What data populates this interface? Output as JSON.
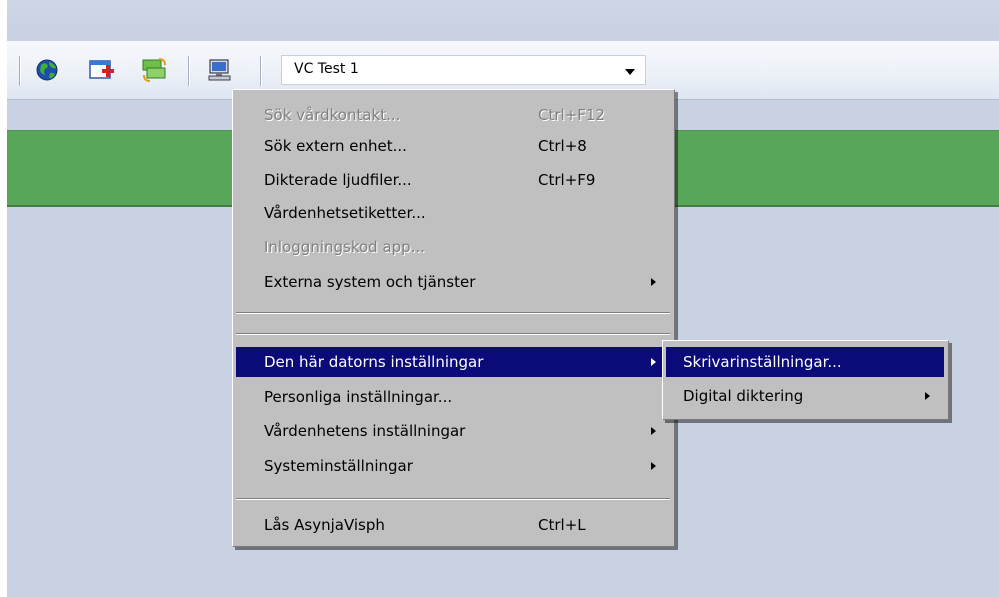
{
  "toolbar": {
    "buttons": [
      {
        "icon": "globe-icon"
      },
      {
        "icon": "add-window-icon"
      },
      {
        "icon": "money-exchange-icon"
      },
      {
        "icon": "computer-icon"
      }
    ],
    "combo_value": "VC Test 1"
  },
  "menu": {
    "items": [
      {
        "label": "Sök vårdkontakt...",
        "shortcut": "Ctrl+F12",
        "disabled": true
      },
      {
        "label": "Sök extern enhet...",
        "shortcut": "Ctrl+8"
      },
      {
        "label": "Dikterade ljudfiler...",
        "shortcut": "Ctrl+F9"
      },
      {
        "label": "Vårdenhetsetiketter..."
      },
      {
        "label": "Inloggningskod app...",
        "disabled": true
      },
      {
        "label": "Externa system och tjänster",
        "submenu": true
      },
      {
        "label": "Den här datorns inställningar",
        "submenu": true,
        "selected": true
      },
      {
        "label": "Personliga inställningar..."
      },
      {
        "label": "Vårdenhetens inställningar",
        "submenu": true
      },
      {
        "label": "Systeminställningar",
        "submenu": true
      },
      {
        "label": "Lås AsynjaVisph",
        "shortcut": "Ctrl+L"
      }
    ]
  },
  "submenu": {
    "items": [
      {
        "label": "Skrivarinställningar...",
        "selected": true
      },
      {
        "label": "Digital diktering",
        "submenu": true
      }
    ]
  },
  "colors": {
    "menu_bg": "#c0c0c0",
    "highlight": "#0a0a78",
    "green_bar": "#57a659",
    "background": "#c8d2e3"
  }
}
